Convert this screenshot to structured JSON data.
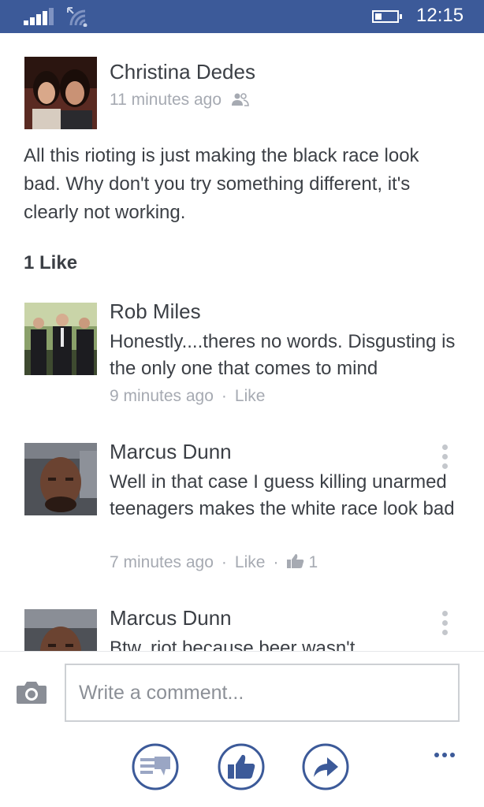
{
  "status_bar": {
    "time": "12:15"
  },
  "post": {
    "author": "Christina Dedes",
    "timestamp": "11 minutes ago",
    "text": "All this rioting is just making the black race look bad. Why don't you try something different, it's clearly not working.",
    "likes_label": "1 Like"
  },
  "comments": [
    {
      "author": "Rob Miles",
      "text": "Honestly....theres no words. Disgusting is the only one that comes to mind",
      "timestamp": "9 minutes ago",
      "like_label": "Like",
      "like_count": ""
    },
    {
      "author": "Marcus Dunn",
      "text": "Well in that case I guess killing unarmed teenagers makes the white race look bad",
      "timestamp": "7 minutes ago",
      "like_label": "Like",
      "like_count": "1"
    },
    {
      "author": "Marcus Dunn",
      "text": "Btw, riot because beer wasn't"
    }
  ],
  "composer": {
    "placeholder": "Write a comment..."
  },
  "icons": {
    "camera": "camera-icon",
    "comment": "comment-icon",
    "like": "like-icon",
    "share": "share-icon",
    "more": "more-dots-icon"
  },
  "colors": {
    "brand": "#3c5a99",
    "meta_text": "#a6aab2"
  }
}
